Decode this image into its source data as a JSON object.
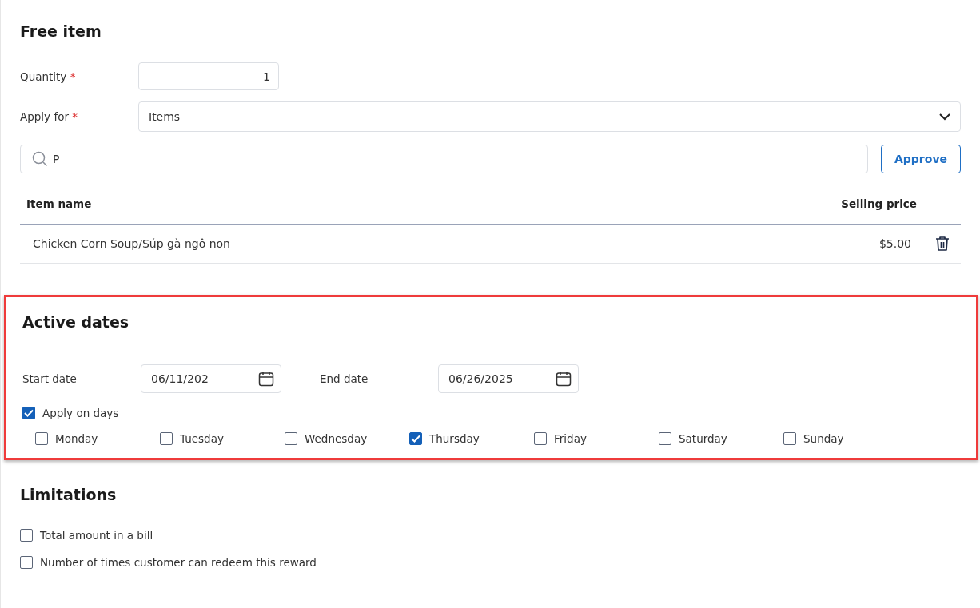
{
  "free_item": {
    "title": "Free item",
    "quantity": {
      "label": "Quantity",
      "required_mark": "*",
      "value": "1"
    },
    "apply_for": {
      "label": "Apply for",
      "required_mark": "*",
      "value": "Items"
    },
    "search": {
      "value": "P"
    },
    "approve_button": "Approve",
    "table": {
      "columns": [
        "Item name",
        "Selling price"
      ],
      "rows": [
        {
          "item_name": "Chicken Corn Soup/Súp gà ngô non",
          "selling_price": "$5.00"
        }
      ]
    }
  },
  "active_dates": {
    "title": "Active dates",
    "highlighted": true,
    "start_date": {
      "label": "Start date",
      "value": "06/11/202"
    },
    "end_date": {
      "label": "End date",
      "value": "06/26/2025"
    },
    "apply_on_days": {
      "label": "Apply on days",
      "checked": true
    },
    "days": [
      {
        "label": "Monday",
        "checked": false
      },
      {
        "label": "Tuesday",
        "checked": false
      },
      {
        "label": "Wednesday",
        "checked": false
      },
      {
        "label": "Thursday",
        "checked": true
      },
      {
        "label": "Friday",
        "checked": false
      },
      {
        "label": "Saturday",
        "checked": false
      },
      {
        "label": "Sunday",
        "checked": false
      }
    ]
  },
  "limitations": {
    "title": "Limitations",
    "options": [
      {
        "label": "Total amount in a bill",
        "checked": false
      },
      {
        "label": "Number of times customer can redeem this reward",
        "checked": false
      }
    ]
  }
}
